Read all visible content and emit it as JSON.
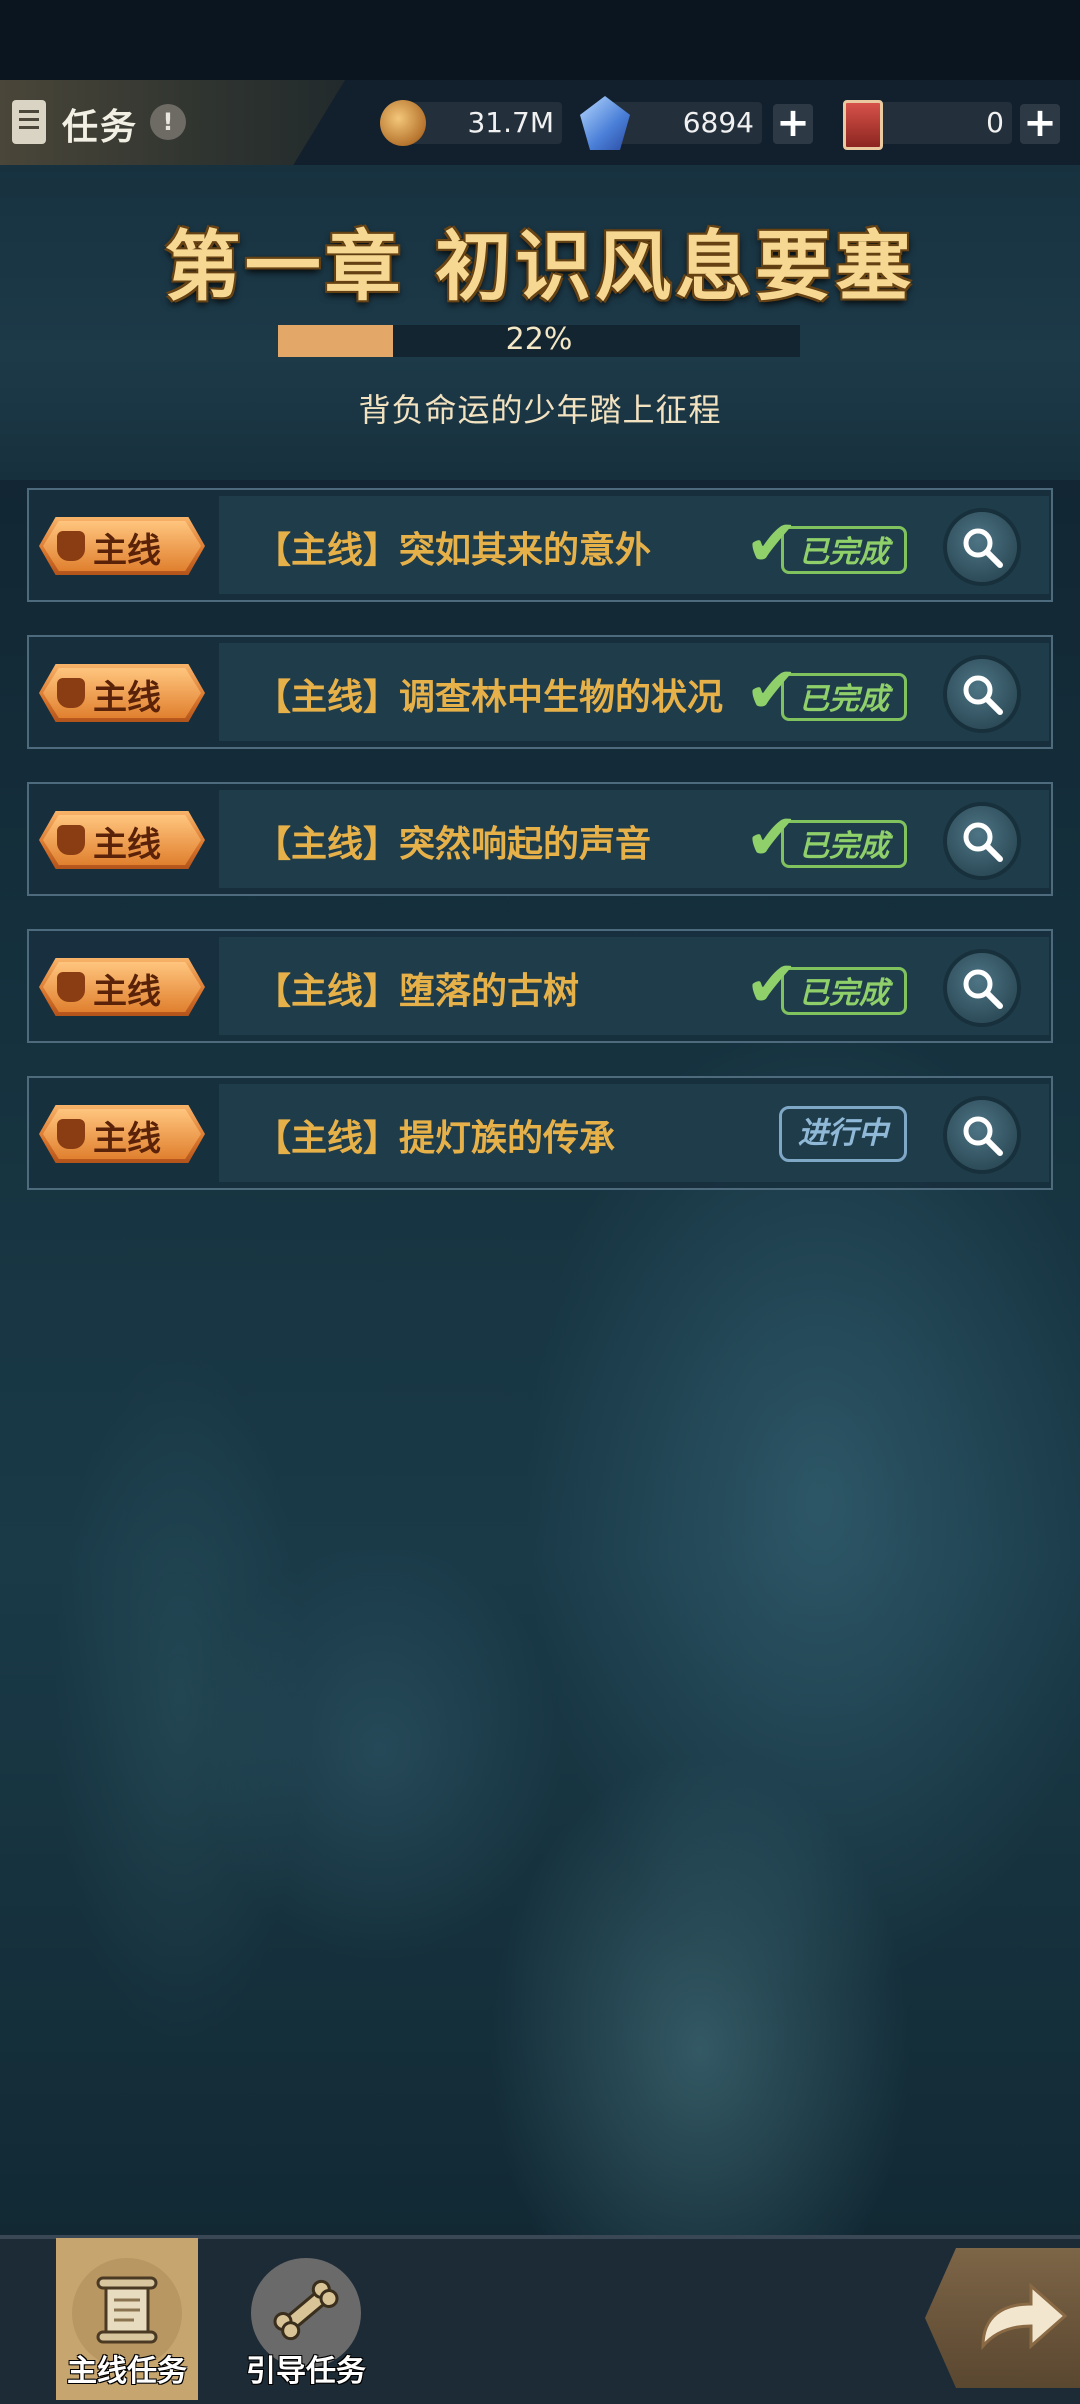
{
  "header": {
    "title": "任务",
    "info_icon": "!",
    "gold_value": "31.7M",
    "gem_value": "6894",
    "card_value": "0",
    "plus_label": "+"
  },
  "chapter": {
    "title": "第一章 初识风息要塞",
    "progress_text": "22%",
    "progress_value": 0.22,
    "subtitle": "背负命运的少年踏上征程"
  },
  "badge_label": "主线",
  "quests": [
    {
      "name": "【主线】突如其来的意外",
      "status": "已完成"
    },
    {
      "name": "【主线】调查林中生物的状况",
      "status": "已完成"
    },
    {
      "name": "【主线】突然响起的声音",
      "status": "已完成"
    },
    {
      "name": "【主线】堕落的古树",
      "status": "已完成"
    },
    {
      "name": "【主线】提灯族的传承",
      "status": "进行中"
    }
  ],
  "nav": {
    "tabs": [
      {
        "label": "主线任务",
        "active": true
      },
      {
        "label": "引导任务",
        "active": false
      }
    ]
  },
  "colors": {
    "accent_gold": "#e7b14a",
    "done_green": "#8fd06a",
    "progress_blue": "#8fb9d6",
    "progress_fill": "#e3a868"
  },
  "icons": [
    "document-icon",
    "info-icon",
    "gold-coin-icon",
    "crystal-icon",
    "card-icon",
    "plus-icon",
    "badge-emblem-icon",
    "check-icon",
    "search-icon",
    "scroll-icon",
    "bone-icon",
    "arrow-return-icon"
  ]
}
